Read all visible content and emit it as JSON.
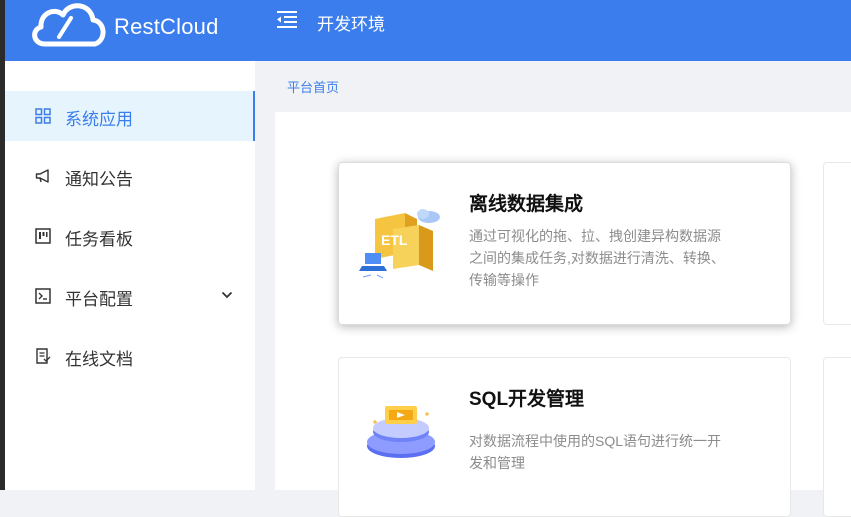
{
  "header": {
    "brand": "RestCloud",
    "environment": "开发环境",
    "colors": {
      "header_bg": "#3b7ded",
      "accent": "#3b7ded"
    },
    "icons": {
      "logo": "cloud-logo-icon",
      "collapse": "menu-fold-icon"
    }
  },
  "sidebar": {
    "items": [
      {
        "label": "系统应用",
        "icon": "grid-icon",
        "active": true
      },
      {
        "label": "通知公告",
        "icon": "megaphone-icon"
      },
      {
        "label": "任务看板",
        "icon": "kanban-icon"
      },
      {
        "label": "平台配置",
        "icon": "terminal-icon",
        "expandable": true
      },
      {
        "label": "在线文档",
        "icon": "document-icon"
      }
    ]
  },
  "breadcrumb": {
    "current": "平台首页"
  },
  "cards": [
    {
      "title": "离线数据集成",
      "description": "通过可视化的拖、拉、拽创建异构数据源之间的集成任务,对数据进行清洗、转换、传输等操作",
      "icon": "etl-illustration-icon"
    },
    {
      "title": "SQL开发管理",
      "description": "对数据流程中使用的SQL语句进行统一开发和管理",
      "icon": "sql-illustration-icon"
    }
  ]
}
